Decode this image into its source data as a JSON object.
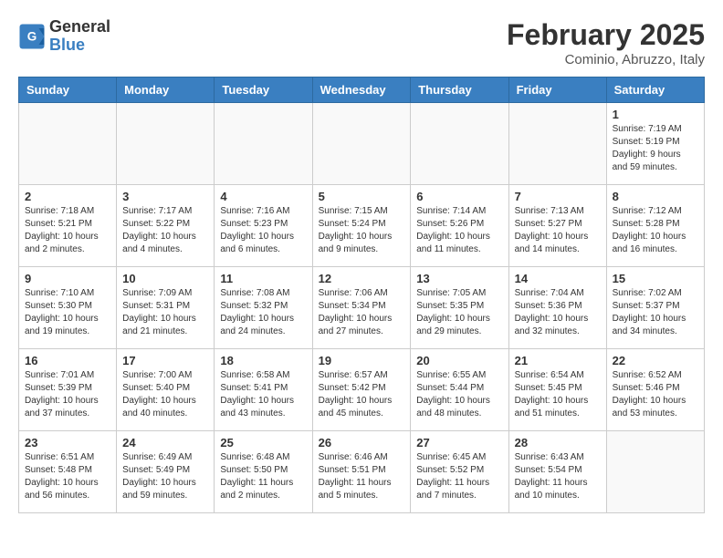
{
  "header": {
    "logo_general": "General",
    "logo_blue": "Blue",
    "month_year": "February 2025",
    "location": "Cominio, Abruzzo, Italy"
  },
  "days_of_week": [
    "Sunday",
    "Monday",
    "Tuesday",
    "Wednesday",
    "Thursday",
    "Friday",
    "Saturday"
  ],
  "weeks": [
    [
      {
        "day": "",
        "info": ""
      },
      {
        "day": "",
        "info": ""
      },
      {
        "day": "",
        "info": ""
      },
      {
        "day": "",
        "info": ""
      },
      {
        "day": "",
        "info": ""
      },
      {
        "day": "",
        "info": ""
      },
      {
        "day": "1",
        "info": "Sunrise: 7:19 AM\nSunset: 5:19 PM\nDaylight: 9 hours and 59 minutes."
      }
    ],
    [
      {
        "day": "2",
        "info": "Sunrise: 7:18 AM\nSunset: 5:21 PM\nDaylight: 10 hours and 2 minutes."
      },
      {
        "day": "3",
        "info": "Sunrise: 7:17 AM\nSunset: 5:22 PM\nDaylight: 10 hours and 4 minutes."
      },
      {
        "day": "4",
        "info": "Sunrise: 7:16 AM\nSunset: 5:23 PM\nDaylight: 10 hours and 6 minutes."
      },
      {
        "day": "5",
        "info": "Sunrise: 7:15 AM\nSunset: 5:24 PM\nDaylight: 10 hours and 9 minutes."
      },
      {
        "day": "6",
        "info": "Sunrise: 7:14 AM\nSunset: 5:26 PM\nDaylight: 10 hours and 11 minutes."
      },
      {
        "day": "7",
        "info": "Sunrise: 7:13 AM\nSunset: 5:27 PM\nDaylight: 10 hours and 14 minutes."
      },
      {
        "day": "8",
        "info": "Sunrise: 7:12 AM\nSunset: 5:28 PM\nDaylight: 10 hours and 16 minutes."
      }
    ],
    [
      {
        "day": "9",
        "info": "Sunrise: 7:10 AM\nSunset: 5:30 PM\nDaylight: 10 hours and 19 minutes."
      },
      {
        "day": "10",
        "info": "Sunrise: 7:09 AM\nSunset: 5:31 PM\nDaylight: 10 hours and 21 minutes."
      },
      {
        "day": "11",
        "info": "Sunrise: 7:08 AM\nSunset: 5:32 PM\nDaylight: 10 hours and 24 minutes."
      },
      {
        "day": "12",
        "info": "Sunrise: 7:06 AM\nSunset: 5:34 PM\nDaylight: 10 hours and 27 minutes."
      },
      {
        "day": "13",
        "info": "Sunrise: 7:05 AM\nSunset: 5:35 PM\nDaylight: 10 hours and 29 minutes."
      },
      {
        "day": "14",
        "info": "Sunrise: 7:04 AM\nSunset: 5:36 PM\nDaylight: 10 hours and 32 minutes."
      },
      {
        "day": "15",
        "info": "Sunrise: 7:02 AM\nSunset: 5:37 PM\nDaylight: 10 hours and 34 minutes."
      }
    ],
    [
      {
        "day": "16",
        "info": "Sunrise: 7:01 AM\nSunset: 5:39 PM\nDaylight: 10 hours and 37 minutes."
      },
      {
        "day": "17",
        "info": "Sunrise: 7:00 AM\nSunset: 5:40 PM\nDaylight: 10 hours and 40 minutes."
      },
      {
        "day": "18",
        "info": "Sunrise: 6:58 AM\nSunset: 5:41 PM\nDaylight: 10 hours and 43 minutes."
      },
      {
        "day": "19",
        "info": "Sunrise: 6:57 AM\nSunset: 5:42 PM\nDaylight: 10 hours and 45 minutes."
      },
      {
        "day": "20",
        "info": "Sunrise: 6:55 AM\nSunset: 5:44 PM\nDaylight: 10 hours and 48 minutes."
      },
      {
        "day": "21",
        "info": "Sunrise: 6:54 AM\nSunset: 5:45 PM\nDaylight: 10 hours and 51 minutes."
      },
      {
        "day": "22",
        "info": "Sunrise: 6:52 AM\nSunset: 5:46 PM\nDaylight: 10 hours and 53 minutes."
      }
    ],
    [
      {
        "day": "23",
        "info": "Sunrise: 6:51 AM\nSunset: 5:48 PM\nDaylight: 10 hours and 56 minutes."
      },
      {
        "day": "24",
        "info": "Sunrise: 6:49 AM\nSunset: 5:49 PM\nDaylight: 10 hours and 59 minutes."
      },
      {
        "day": "25",
        "info": "Sunrise: 6:48 AM\nSunset: 5:50 PM\nDaylight: 11 hours and 2 minutes."
      },
      {
        "day": "26",
        "info": "Sunrise: 6:46 AM\nSunset: 5:51 PM\nDaylight: 11 hours and 5 minutes."
      },
      {
        "day": "27",
        "info": "Sunrise: 6:45 AM\nSunset: 5:52 PM\nDaylight: 11 hours and 7 minutes."
      },
      {
        "day": "28",
        "info": "Sunrise: 6:43 AM\nSunset: 5:54 PM\nDaylight: 11 hours and 10 minutes."
      },
      {
        "day": "",
        "info": ""
      }
    ]
  ]
}
